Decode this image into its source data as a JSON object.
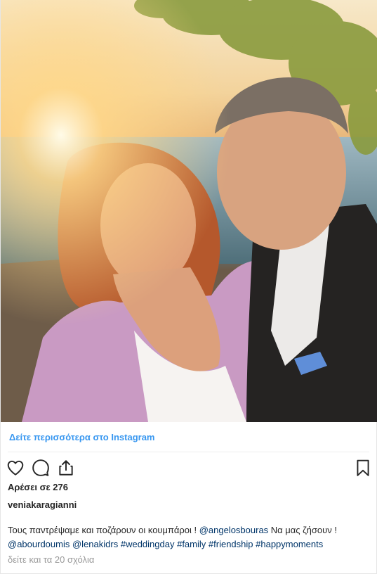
{
  "post": {
    "image_alt": "",
    "view_more": "Δείτε περισσότερα στο Instagram",
    "likes": "Αρέσει σε 276",
    "username": "veniakaragianni",
    "caption_text": "Τους παντρέψαμε και ποζάρουν οι κουμπάροι ! ",
    "mention_1": "@angelosbouras",
    "caption_text_2": " Να μας ζήσουν ! ",
    "mention_2": "@abourdoumis",
    "mention_3": "@lenakidrs",
    "tag_1": "#weddingday",
    "tag_2": "#family",
    "tag_3": "#friendship",
    "tag_4": "#happymoments",
    "comments_link": "δείτε και τα 20 σχόλια"
  },
  "icons": {
    "like": "heart-icon",
    "comment": "comment-icon",
    "share": "share-icon",
    "save": "bookmark-icon"
  },
  "colors": {
    "link_blue": "#3897f0",
    "hashtag": "#003569",
    "muted": "#999999"
  }
}
